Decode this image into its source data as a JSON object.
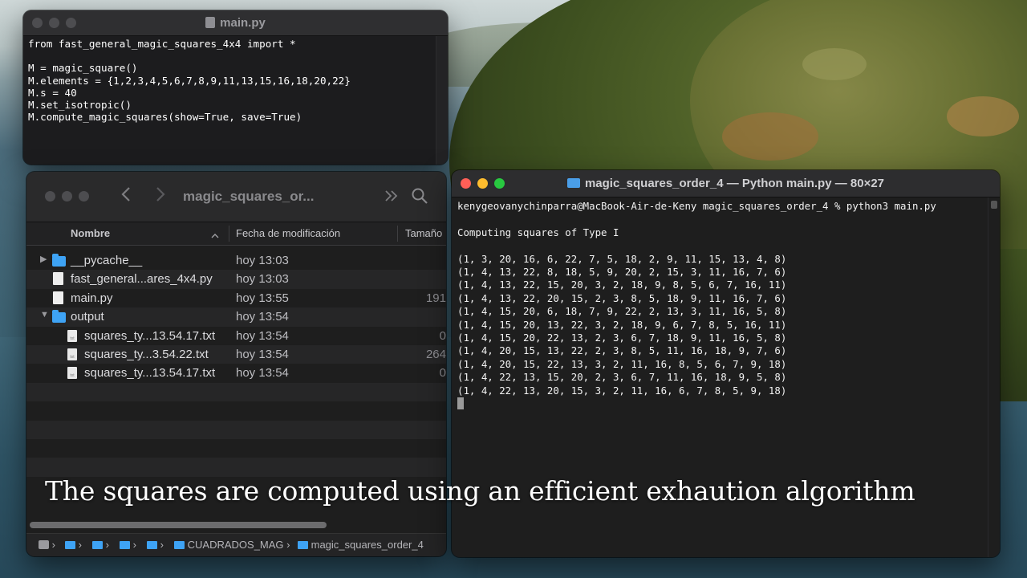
{
  "editor": {
    "title": "main.py",
    "code": "from fast_general_magic_squares_4x4 import *\n\nM = magic_square()\nM.elements = {1,2,3,4,5,6,7,8,9,11,13,15,16,18,20,22}\nM.s = 40\nM.set_isotropic()\nM.compute_magic_squares(show=True, save=True)"
  },
  "finder": {
    "title": "magic_squares_or...",
    "back_icon": "chevron-left",
    "forward_icon": "chevron-right",
    "more_icon": "chevron-double-right",
    "search_icon": "magnifying-glass",
    "columns": {
      "name": "Nombre",
      "date": "Fecha de modificación",
      "size": "Tamaño"
    },
    "items": [
      {
        "name": "__pycache__",
        "date": "hoy 13:03",
        "size": "",
        "kind": "folder",
        "expandable": "collapsed",
        "indent": 0
      },
      {
        "name": "fast_general...ares_4x4.py",
        "date": "hoy 13:03",
        "size": "",
        "kind": "doc",
        "expandable": "",
        "indent": 0
      },
      {
        "name": "main.py",
        "date": "hoy 13:55",
        "size": "191",
        "kind": "doc",
        "expandable": "",
        "indent": 0
      },
      {
        "name": "output",
        "date": "hoy 13:54",
        "size": "",
        "kind": "folder",
        "expandable": "expanded",
        "indent": 0
      },
      {
        "name": "squares_ty...13.54.17.txt",
        "date": "hoy 13:54",
        "size": "0",
        "kind": "txt",
        "expandable": "",
        "indent": 1
      },
      {
        "name": "squares_ty...3.54.22.txt",
        "date": "hoy 13:54",
        "size": "264",
        "kind": "txt",
        "expandable": "",
        "indent": 1
      },
      {
        "name": "squares_ty...13.54.17.txt",
        "date": "hoy 13:54",
        "size": "0",
        "kind": "txt",
        "expandable": "",
        "indent": 1
      }
    ],
    "pathbar": {
      "folder1": "CUADRADOS_MAG",
      "folder2": "magic_squares_order_4"
    }
  },
  "terminal": {
    "title": "magic_squares_order_4 — Python main.py — 80×27",
    "output": "kenygeovanychinparra@MacBook-Air-de-Keny magic_squares_order_4 % python3 main.py\n\nComputing squares of Type I\n\n(1, 3, 20, 16, 6, 22, 7, 5, 18, 2, 9, 11, 15, 13, 4, 8)\n(1, 4, 13, 22, 8, 18, 5, 9, 20, 2, 15, 3, 11, 16, 7, 6)\n(1, 4, 13, 22, 15, 20, 3, 2, 18, 9, 8, 5, 6, 7, 16, 11)\n(1, 4, 13, 22, 20, 15, 2, 3, 8, 5, 18, 9, 11, 16, 7, 6)\n(1, 4, 15, 20, 6, 18, 7, 9, 22, 2, 13, 3, 11, 16, 5, 8)\n(1, 4, 15, 20, 13, 22, 3, 2, 18, 9, 6, 7, 8, 5, 16, 11)\n(1, 4, 15, 20, 22, 13, 2, 3, 6, 7, 18, 9, 11, 16, 5, 8)\n(1, 4, 20, 15, 13, 22, 2, 3, 8, 5, 11, 16, 18, 9, 7, 6)\n(1, 4, 20, 15, 22, 13, 3, 2, 11, 16, 8, 5, 6, 7, 9, 18)\n(1, 4, 22, 13, 15, 20, 2, 3, 6, 7, 11, 16, 18, 9, 5, 8)\n(1, 4, 22, 13, 20, 15, 3, 2, 11, 16, 6, 7, 8, 5, 9, 18)\n"
  },
  "caption": "The squares are computed using an efficient exhaution algorithm",
  "colors": {
    "close": "#ff5f57",
    "minimize": "#febc2e",
    "zoom": "#28c840",
    "folder": "#3ea3f5",
    "terminal_bg": "#1e1e1e"
  }
}
